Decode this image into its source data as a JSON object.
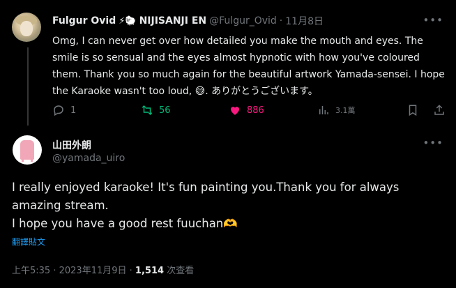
{
  "tweet1": {
    "author_name": "Fulgur Ovid",
    "author_emoji": "⚡🐑",
    "author_tag": "NIJISANJI EN",
    "handle": "@Fulgur_Ovid",
    "separator": "·",
    "date": "11月8日",
    "text": "Omg, I can never get over how detailed you make the mouth and eyes. The smile is so sensual and the eyes almost hypnotic with how you've coloured them. Thank you so much again for the beautiful artwork Yamada-sensei. I hope the Karaoke wasn't too loud, 😅. ありがとうございます。",
    "replies": "1",
    "retweets": "56",
    "likes": "886",
    "views": "3.1萬",
    "more_icon": "ellipsis-icon"
  },
  "tweet2": {
    "author_name": "山田外朗",
    "handle": "@yamada_uiro",
    "body_lines": [
      "I really enjoyed karaoke! It's fun painting you.Thank you for always amazing stream.",
      "I hope you have a good rest fuuchan🫶"
    ],
    "translate_label": "翻譯貼文",
    "time": "上午5:35",
    "date": "2023年11月9日",
    "views_count": "1,514",
    "views_label": "次查看"
  },
  "colors": {
    "background": "#000000",
    "text": "#e7e9ea",
    "muted": "#71767b",
    "retweet": "#00ba7c",
    "like": "#f91880",
    "link": "#1d9bf0"
  }
}
